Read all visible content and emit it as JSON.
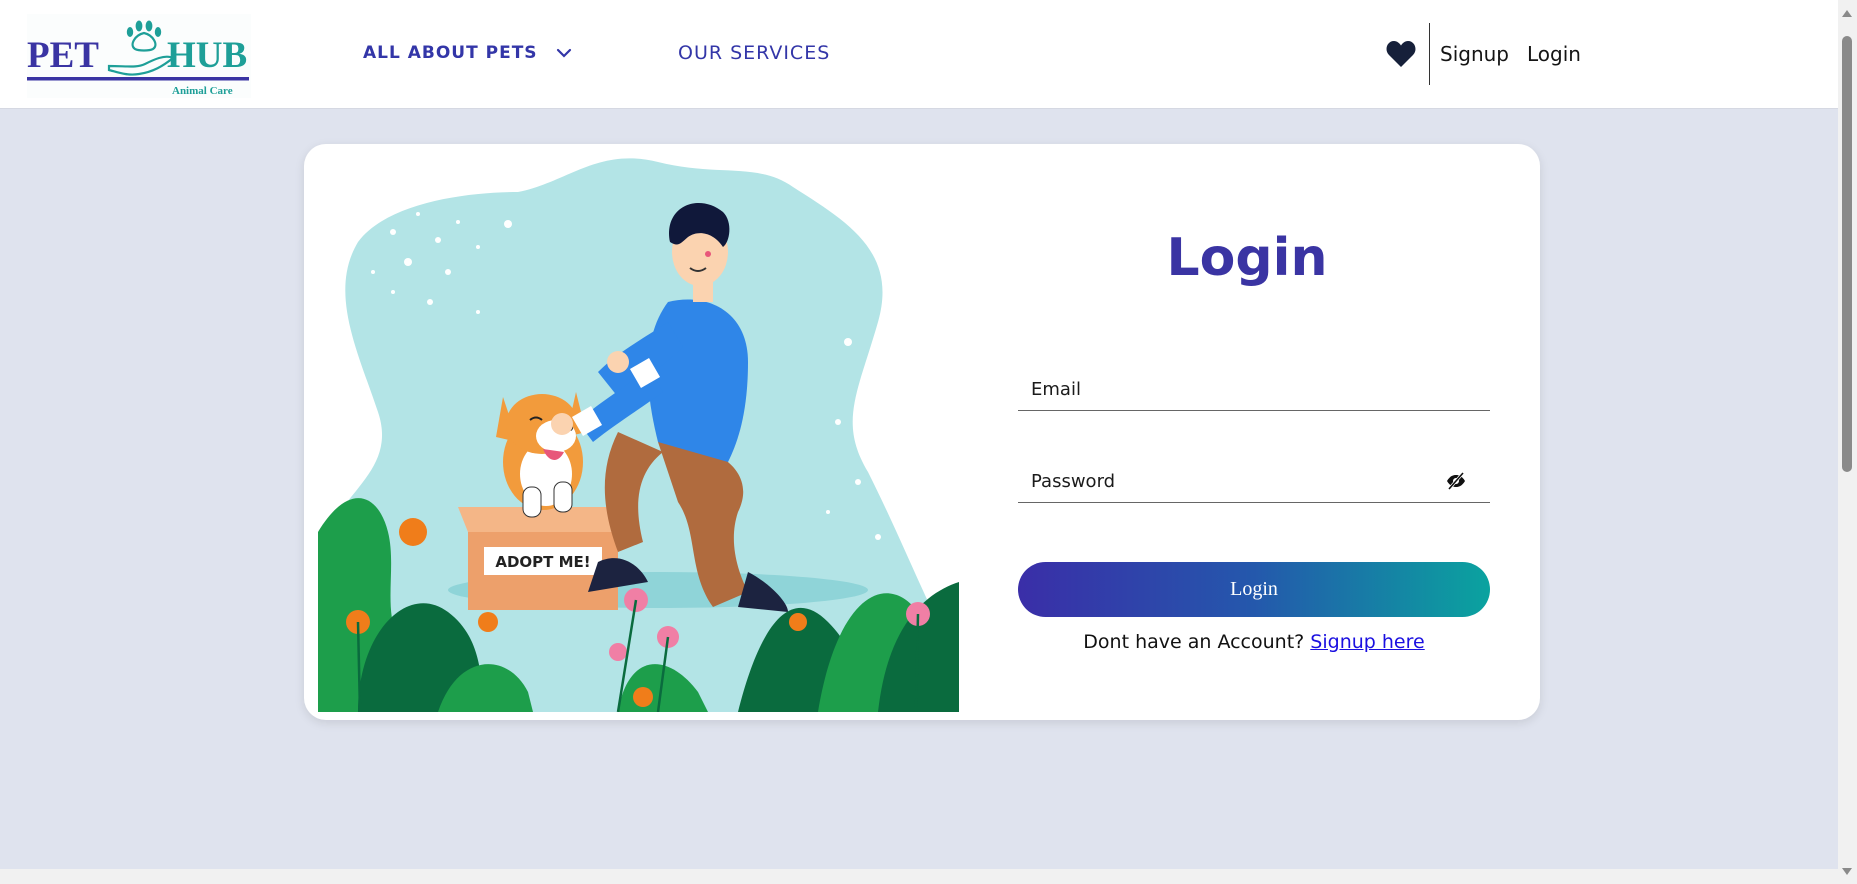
{
  "header": {
    "logo": {
      "word1": "PET",
      "word2": "HUB",
      "tagline": "Animal Care"
    },
    "nav": {
      "all_about_pets": "ALL ABOUT PETS",
      "our_services": "OUR SERVICES"
    },
    "signup": "Signup",
    "login": "Login"
  },
  "illustration": {
    "box_label": "ADOPT ME!"
  },
  "login": {
    "title": "Login",
    "email_placeholder": "Email",
    "password_placeholder": "Password",
    "button": "Login",
    "no_account": "Dont have an Account?",
    "signup_link": "Signup here"
  },
  "icons": {
    "nav_dropdown": "chevron-down-icon",
    "favorites": "heart-icon",
    "password_toggle": "eye-off-icon"
  },
  "colors": {
    "primary": "#3a34a3",
    "teal": "#0aa39f",
    "background": "#dfe3ee",
    "link": "#1a0fe0"
  }
}
